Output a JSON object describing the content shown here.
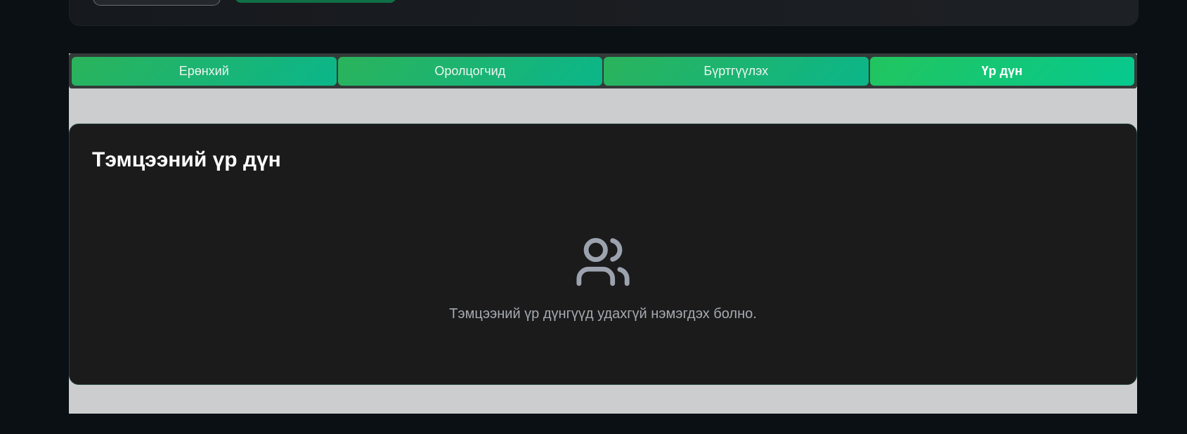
{
  "tabs": [
    {
      "label": "Ерөнхий"
    },
    {
      "label": "Оролцогчид"
    },
    {
      "label": "Бүртгүүлэх"
    },
    {
      "label": "Үр дүн"
    }
  ],
  "active_tab": "Үр дүн",
  "results": {
    "title": "Тэмцээний үр дүн",
    "empty_icon": "users-icon",
    "empty_message": "Тэмцээний үр дүнгүүд удахгүй нэмэгдэх болно."
  },
  "colors": {
    "page_bg": "#0b1014",
    "tab_gradient_start": "#2bb35b",
    "tab_gradient_end": "#0bb68a",
    "card_bg": "#1b1b1b",
    "panel_bg": "#cccdce"
  }
}
